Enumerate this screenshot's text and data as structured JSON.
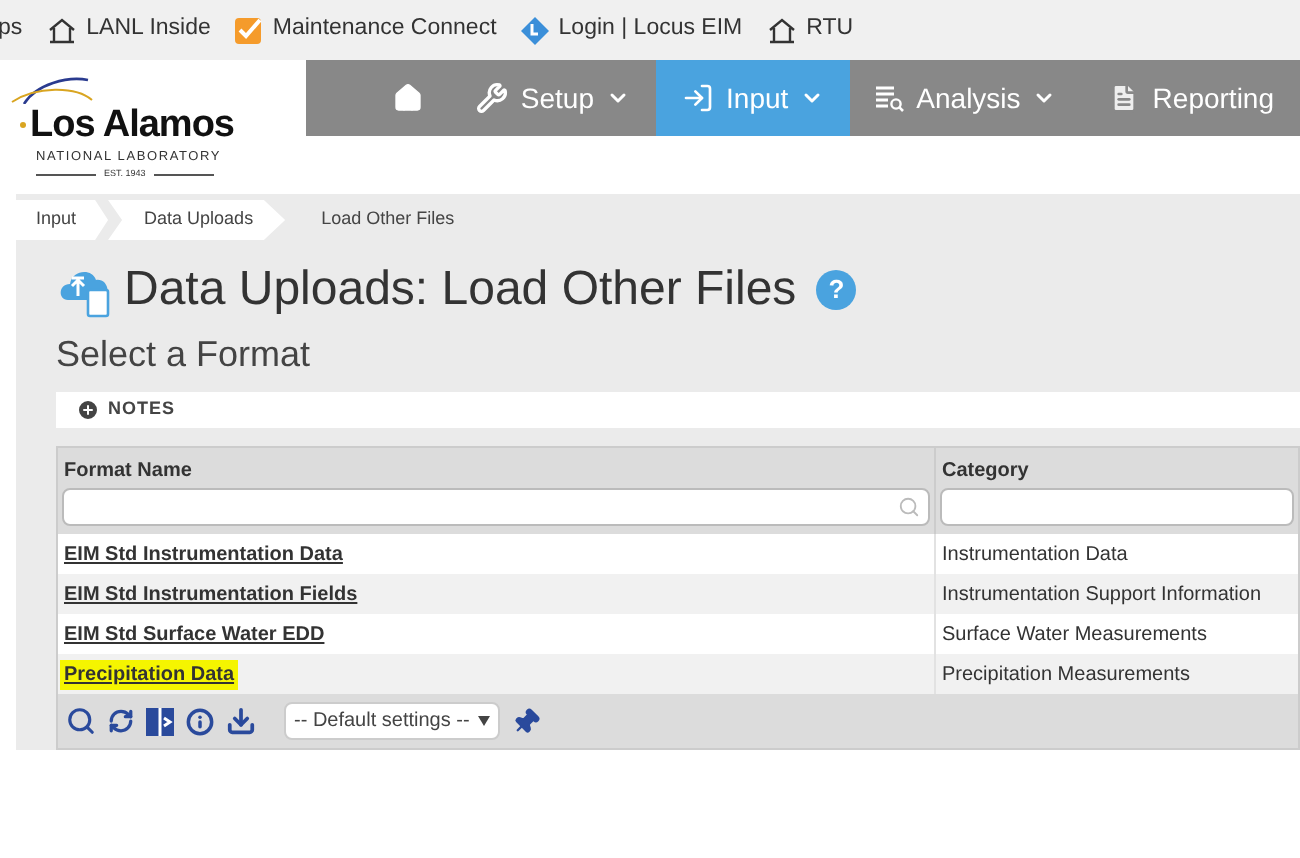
{
  "bookmarks": [
    {
      "label": "ps",
      "kind": "text"
    },
    {
      "label": "LANL Inside",
      "kind": "lanl"
    },
    {
      "label": "Maintenance Connect",
      "kind": "check"
    },
    {
      "label": "Login | Locus EIM",
      "kind": "locus"
    },
    {
      "label": "RTU",
      "kind": "lanl"
    }
  ],
  "logo": {
    "name": "Los Alamos",
    "subtitle": "NATIONAL LABORATORY",
    "established": "EST. 1943"
  },
  "nav": [
    {
      "kind": "home",
      "selected": false
    },
    {
      "kind": "setup",
      "label": "Setup",
      "selected": false
    },
    {
      "kind": "input",
      "label": "Input",
      "selected": true
    },
    {
      "kind": "analysis",
      "label": "Analysis",
      "selected": false
    },
    {
      "kind": "reporting",
      "label": "Reporting",
      "selected": false
    }
  ],
  "breadcrumb": [
    {
      "label": "Input",
      "current": false
    },
    {
      "label": "Data Uploads",
      "current": false
    },
    {
      "label": "Load Other Files",
      "current": true
    }
  ],
  "title": "Data Uploads: Load Other Files",
  "subtitle": "Select a Format",
  "help_label": "?",
  "notes_label": "NOTES",
  "table": {
    "columns": [
      "Format Name",
      "Category"
    ],
    "rows": [
      {
        "name": "EIM Std Instrumentation Data",
        "category": "Instrumentation Data",
        "highlighted": false
      },
      {
        "name": "EIM Std Instrumentation Fields",
        "category": "Instrumentation Support Information",
        "highlighted": false
      },
      {
        "name": "EIM Std Surface Water EDD",
        "category": "Surface Water Measurements",
        "highlighted": false
      },
      {
        "name": "Precipitation Data",
        "category": "Precipitation Measurements",
        "highlighted": true
      }
    ]
  },
  "settings_select": {
    "value": "-- Default settings --"
  }
}
